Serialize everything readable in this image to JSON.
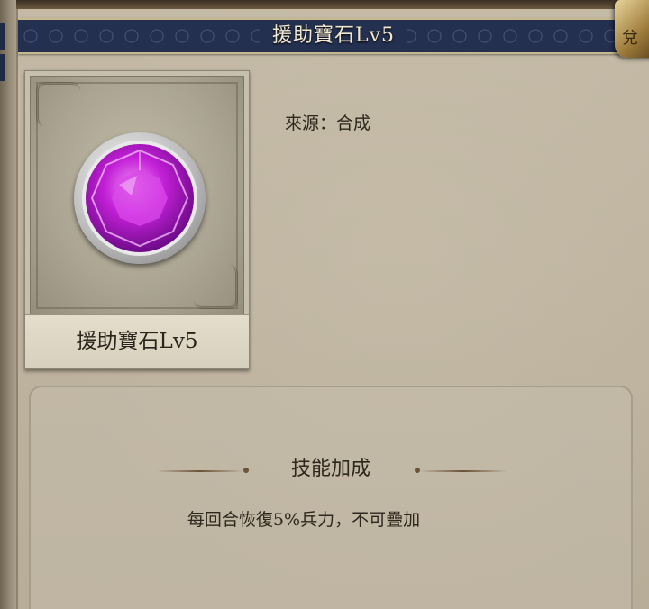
{
  "header": {
    "title": "援助寶石Lv5",
    "corner_glyph": "兌"
  },
  "item_card": {
    "name": "援助寶石Lv5",
    "gem_color": "#b31bd1"
  },
  "info": {
    "source_label": "來源：合成"
  },
  "skill": {
    "heading": "技能加成",
    "description": "每回合恢復5%兵力，不可疊加"
  }
}
